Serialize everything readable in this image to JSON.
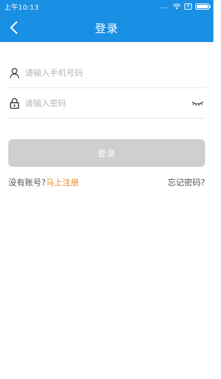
{
  "status_bar": {
    "time": "上午10:13",
    "dots": "...",
    "sim": "✕"
  },
  "nav": {
    "title": "登录"
  },
  "form": {
    "phone_placeholder": "请输入手机号码",
    "password_placeholder": "请输入密码",
    "login_label": "登录"
  },
  "links": {
    "no_account": "没有账号?",
    "register": "马上注册",
    "forgot": "忘记密码?"
  },
  "colors": {
    "primary": "#1a90e4",
    "link_accent": "#f08a1c",
    "button_disabled": "#cfcfcf"
  },
  "icons": {
    "back": "chevron-left-icon",
    "user": "user-icon",
    "lock": "lock-icon",
    "eye": "eye-closed-icon",
    "wifi": "wifi-icon",
    "battery": "battery-icon"
  }
}
